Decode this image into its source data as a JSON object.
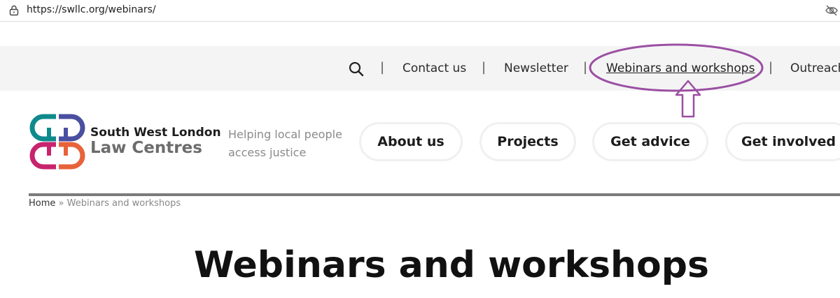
{
  "browser": {
    "url": "https://swllc.org/webinars/",
    "icons": [
      "lock-icon",
      "eye-off-icon"
    ]
  },
  "utility_nav": {
    "search_icon": "search-icon",
    "separator": "|",
    "links": [
      {
        "label": "Contact us"
      },
      {
        "label": "Newsletter"
      },
      {
        "label": "Webinars and workshops",
        "active": true
      },
      {
        "label": "Outreach"
      }
    ]
  },
  "annotation": {
    "shape": "ellipse-and-up-arrow",
    "color": "#9b4fa3"
  },
  "header": {
    "brand_line1": "South West London",
    "brand_line2": "Law Centres",
    "tagline": "Helping local people access justice",
    "logo_colors": [
      "#0e8a8c",
      "#4a4fa0",
      "#c8246e",
      "#e8623a"
    ],
    "nav": [
      {
        "label": "About us"
      },
      {
        "label": "Projects"
      },
      {
        "label": "Get advice"
      },
      {
        "label": "Get involved"
      }
    ]
  },
  "breadcrumb": {
    "home": "Home",
    "separator": "»",
    "current": "Webinars and workshops"
  },
  "page": {
    "title": "Webinars and workshops"
  }
}
